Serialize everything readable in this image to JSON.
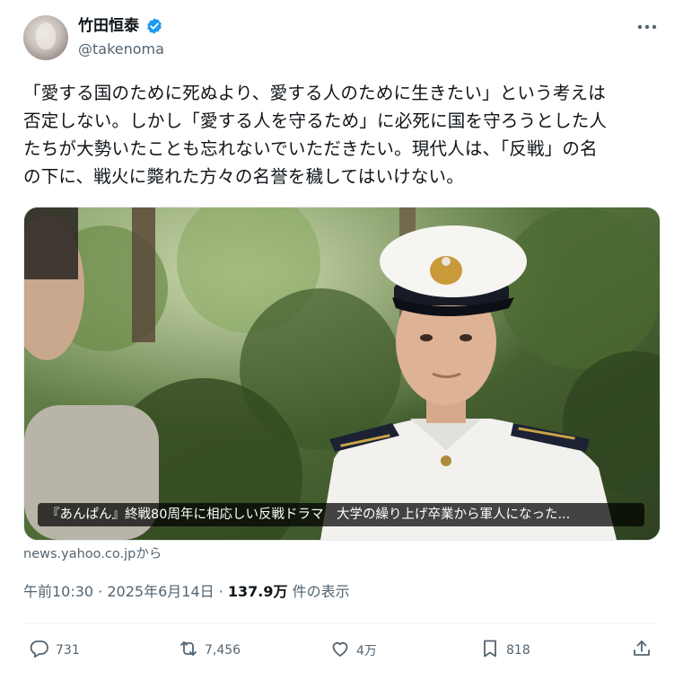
{
  "author": {
    "display_name": "竹田恒泰",
    "handle": "@takenoma",
    "verified": true
  },
  "post": {
    "text": "「愛する国のために死ぬより、愛する人のために生きたい」という考えは\n否定しない。しかし「愛する人を守るため」に必死に国を守ろうとした人\nたちが大勢いたことも忘れないでいただきたい。現代人は、「反戦」の名\nの下に、戦火に斃れた方々の名誉を穢してはいけない。",
    "card_caption": "『あんぱん』終戦80周年に相応しい反戦ドラマ　大学の繰り上げ卒業から軍人になった...",
    "source": "news.yahoo.co.jpから",
    "timestamp": "午前10:30 · 2025年6月14日 · ",
    "views_count": "137.9万",
    "views_label": " 件の表示"
  },
  "actions": {
    "replies": "731",
    "reposts": "7,456",
    "likes": "4万",
    "bookmarks": "818"
  },
  "colors": {
    "verified_blue": "#1d9bf0",
    "secondary_text": "#536471",
    "primary_text": "#0f1419"
  },
  "icons": [
    "verified-badge-icon",
    "more-icon",
    "reply-icon",
    "repost-icon",
    "like-icon",
    "bookmark-icon",
    "share-icon"
  ]
}
